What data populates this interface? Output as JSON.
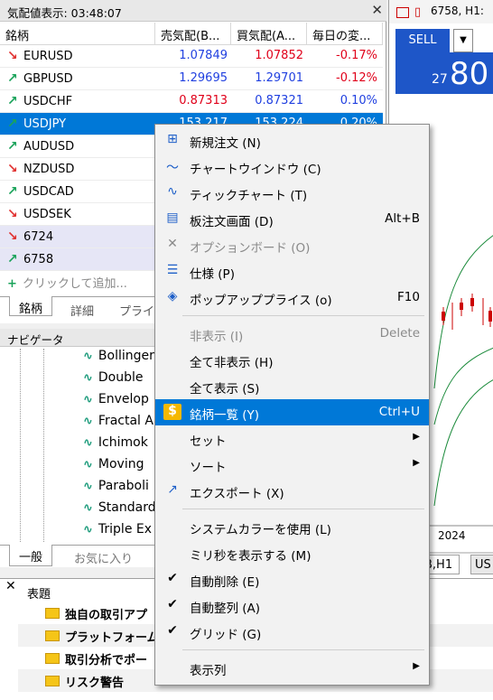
{
  "market_watch": {
    "title": "気配値表示: 03:48:07",
    "close": "✕",
    "columns": [
      "銘柄",
      "売気配(B...",
      "買気配(A...",
      "毎日の変..."
    ],
    "rows": [
      {
        "symbol": "EURUSD",
        "dir": "down",
        "bid": "1.07849",
        "ask": "1.07852",
        "change": "-0.17%",
        "bid_color": "blue",
        "ask_color": "red",
        "chg_color": "red"
      },
      {
        "symbol": "GBPUSD",
        "dir": "up",
        "bid": "1.29695",
        "ask": "1.29701",
        "change": "-0.12%",
        "bid_color": "blue",
        "ask_color": "blue",
        "chg_color": "red"
      },
      {
        "symbol": "USDCHF",
        "dir": "up",
        "bid": "0.87313",
        "ask": "0.87321",
        "change": "0.10%",
        "bid_color": "red",
        "ask_color": "blue",
        "chg_color": "blue"
      },
      {
        "symbol": "USDJPY",
        "dir": "up",
        "bid": "153.217",
        "ask": "153.224",
        "change": "0.20%",
        "selected": true
      },
      {
        "symbol": "AUDUSD",
        "dir": "up",
        "bid": "",
        "ask": "",
        "change": ""
      },
      {
        "symbol": "NZDUSD",
        "dir": "down",
        "bid": "",
        "ask": "",
        "change": ""
      },
      {
        "symbol": "USDCAD",
        "dir": "up",
        "bid": "",
        "ask": "",
        "change": ""
      },
      {
        "symbol": "USDSEK",
        "dir": "down",
        "bid": "",
        "ask": "",
        "change": ""
      },
      {
        "symbol": "6724",
        "dir": "down",
        "bid": "",
        "ask": "",
        "change": "",
        "alt": true
      },
      {
        "symbol": "6758",
        "dir": "up",
        "bid": "",
        "ask": "",
        "change": "",
        "alt": true
      }
    ],
    "add_label": "クリックして追加...",
    "tabs": [
      "銘柄",
      "詳細",
      "プライス"
    ]
  },
  "navigator": {
    "title": "ナビゲータ",
    "items": [
      "Bollinger",
      "Double",
      "Envelop",
      "Fractal A",
      "Ichimok",
      "Moving",
      "Paraboli",
      "Standard",
      "Triple Ex"
    ],
    "tabs": [
      "一般",
      "お気に入り"
    ]
  },
  "chart": {
    "header": "6758, H1:",
    "sell_label": "SELL",
    "price_small": "27",
    "price_big": "80",
    "date_label": "2024",
    "tabs": [
      "B,H1",
      "US"
    ]
  },
  "news": {
    "header": "表題",
    "items": [
      "独自の取引アプ",
      "プラットフォームが",
      "取引分析でポー",
      "リスク警告"
    ]
  },
  "menu": {
    "items": [
      {
        "label": "新規注文 (N)",
        "icon": "new-order-icon",
        "glyph": "⊞"
      },
      {
        "label": "チャートウインドウ (C)",
        "icon": "chart-window-icon",
        "glyph": "〜"
      },
      {
        "label": "ティックチャート (T)",
        "icon": "tick-chart-icon",
        "glyph": "∿"
      },
      {
        "label": "板注文画面 (D)",
        "icon": "depth-of-market-icon",
        "glyph": "▤",
        "shortcut": "Alt+B"
      },
      {
        "label": "オプションボード (O)",
        "icon": "option-board-icon",
        "glyph": "✕",
        "disabled": true
      },
      {
        "label": "仕様 (P)",
        "icon": "specification-icon",
        "glyph": "☰"
      },
      {
        "label": "ポップアッププライス (o)",
        "icon": "popup-prices-icon",
        "glyph": "◈",
        "shortcut": "F10"
      },
      {
        "sep": true
      },
      {
        "label": "非表示 (I)",
        "shortcut": "Delete",
        "disabled": true
      },
      {
        "label": "全て非表示 (H)"
      },
      {
        "label": "全て表示 (S)"
      },
      {
        "label": "銘柄一覧 (Y)",
        "icon": "symbols-icon",
        "glyph": "$",
        "shortcut": "Ctrl+U",
        "highlighted": true
      },
      {
        "label": "セット",
        "submenu": true
      },
      {
        "label": "ソート",
        "submenu": true
      },
      {
        "label": "エクスポート (X)",
        "icon": "export-icon",
        "glyph": "↗"
      },
      {
        "sep": true
      },
      {
        "label": "システムカラーを使用 (L)"
      },
      {
        "label": "ミリ秒を表示する (M)"
      },
      {
        "label": "自動削除 (E)",
        "checked": true
      },
      {
        "label": "自動整列 (A)",
        "checked": true
      },
      {
        "label": "グリッド (G)",
        "checked": true
      },
      {
        "sep": true
      },
      {
        "label": "表示列",
        "submenu": true
      }
    ],
    "check_glyph": "✔",
    "submenu_glyph": "▶"
  },
  "colors": {
    "accent": "#0078d7",
    "sell": "#1e56c8",
    "up": "#1aa35a",
    "down": "#e0302f"
  }
}
